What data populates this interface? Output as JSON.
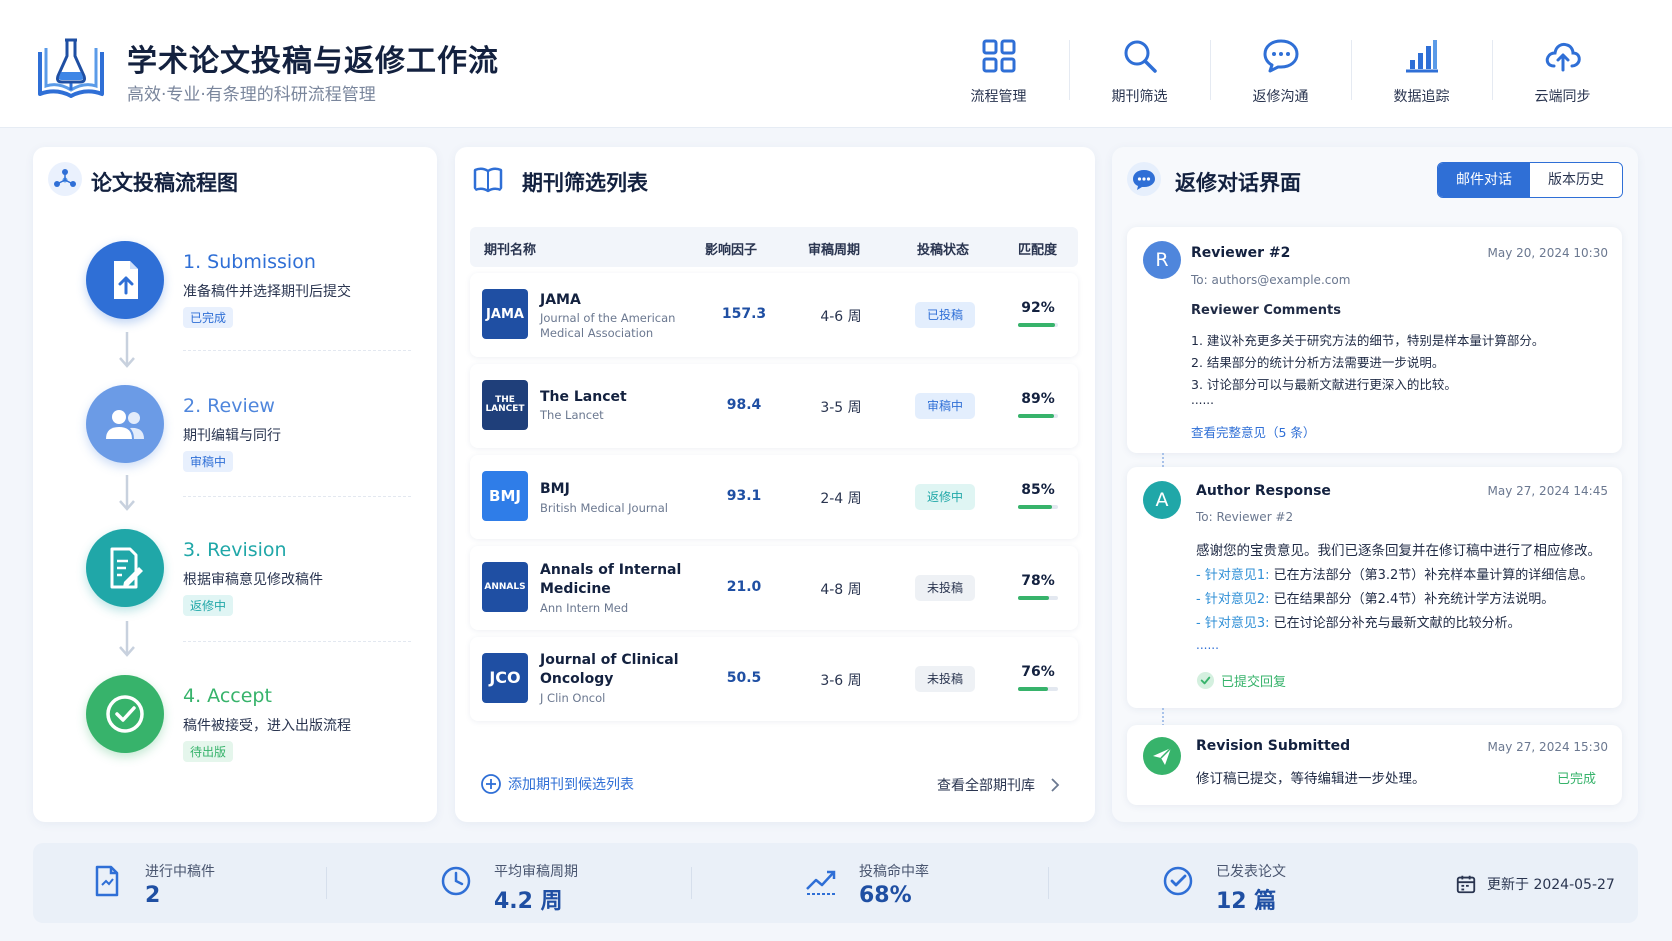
{
  "header": {
    "title": "学术论文投稿与返修工作流",
    "subtitle": "高效·专业·有条理的科研流程管理",
    "nav": [
      {
        "label": "流程管理",
        "icon": "grid-icon"
      },
      {
        "label": "期刊筛选",
        "icon": "search-icon"
      },
      {
        "label": "返修沟通",
        "icon": "chat-icon"
      },
      {
        "label": "数据追踪",
        "icon": "bar-chart-icon"
      },
      {
        "label": "云端同步",
        "icon": "cloud-upload-icon"
      }
    ]
  },
  "flow": {
    "title": "论文投稿流程图",
    "steps": [
      {
        "name": "1. Submission",
        "desc": "准备稿件并选择期刊后提交",
        "badge": "已完成",
        "color": "#2f6fd6",
        "icon": "upload-file-icon"
      },
      {
        "name": "2. Review",
        "desc": "期刊编辑与同行",
        "badge": "审稿中",
        "color": "#5b8fe0",
        "icon": "users-icon"
      },
      {
        "name": "3. Revision",
        "desc": "根据审稿意见修改稿件",
        "badge": "返修中",
        "color": "#20a7a8",
        "icon": "edit-document-icon"
      },
      {
        "name": "4. Accept",
        "desc": "稿件被接受，进入出版流程",
        "badge": "待出版",
        "color": "#37b36b",
        "icon": "check-circle-icon"
      }
    ]
  },
  "journals": {
    "title": "期刊筛选列表",
    "headers": [
      "期刊名称",
      "影响因子",
      "审稿周期",
      "投稿状态",
      "匹配度"
    ],
    "rows": [
      {
        "logo": "JAMA",
        "name": "JAMA",
        "sub": "Journal of the American Medical Association",
        "if": "157.3",
        "cycle": "4-6 周",
        "status": "已投稿",
        "status_kind": "blue",
        "match": "92%",
        "match_value": 0.92
      },
      {
        "logo": "THE LANCET",
        "name": "The Lancet",
        "sub": "The Lancet",
        "if": "98.4",
        "cycle": "3-5 周",
        "status": "审稿中",
        "status_kind": "blue",
        "match": "89%",
        "match_value": 0.89
      },
      {
        "logo": "BMJ",
        "name": "BMJ",
        "sub": "British Medical Journal",
        "if": "93.1",
        "cycle": "2-4 周",
        "status": "返修中",
        "status_kind": "teal",
        "match": "85%",
        "match_value": 0.85
      },
      {
        "logo": "ANNALS",
        "name": "Annals of Internal Medicine",
        "sub": "Ann Intern Med",
        "if": "21.0",
        "cycle": "4-8 周",
        "status": "未投稿",
        "status_kind": "gray",
        "match": "78%",
        "match_value": 0.78
      },
      {
        "logo": "JCO",
        "name": "Journal of Clinical Oncology",
        "sub": "J Clin Oncol",
        "if": "50.5",
        "cycle": "3-6 周",
        "status": "未投稿",
        "status_kind": "gray",
        "match": "76%",
        "match_value": 0.76
      }
    ],
    "add_link": "添加期刊到候选列表",
    "view_all": "查看全部期刊库"
  },
  "revision": {
    "title": "返修对话界面",
    "tabs": [
      "邮件对话",
      "版本历史"
    ],
    "messages": [
      {
        "avatar": "R",
        "from": "Reviewer #2",
        "date": "May 20, 2024  10:30",
        "to": "To: authors@example.com",
        "heading": "Reviewer Comments",
        "lines": [
          "1. 建议补充更多关于研究方法的细节，特别是样本量计算部分。",
          "2. 结果部分的统计分析方法需要进一步说明。",
          "3. 讨论部分可以与最新文献进行更深入的比较。",
          "......"
        ],
        "link": "查看完整意见（5 条）"
      },
      {
        "avatar": "A",
        "from": "Author Response",
        "date": "May 27, 2024  14:45",
        "to": "To: Reviewer #2",
        "intro": "感谢您的宝贵意见。我们已逐条回复并在修订稿中进行了相应修改。",
        "points": [
          {
            "tag": "- 针对意见1:",
            "text": "已在方法部分（第3.2节）补充样本量计算的详细信息。"
          },
          {
            "tag": "- 针对意见2:",
            "text": "已在结果部分（第2.4节）补充统计学方法说明。"
          },
          {
            "tag": "- 针对意见3:",
            "text": "已在讨论部分补充与最新文献的比较分析。"
          }
        ],
        "ellipsis": "......",
        "status": "已提交回复"
      },
      {
        "from": "Revision Submitted",
        "date": "May 27, 2024  15:30",
        "text": "修订稿已提交，等待编辑进一步处理。",
        "status": "已完成"
      }
    ]
  },
  "stats": [
    {
      "label": "进行中稿件",
      "value": "2",
      "icon": "document-icon"
    },
    {
      "label": "平均审稿周期",
      "value": "4.2 周",
      "icon": "clock-icon"
    },
    {
      "label": "投稿命中率",
      "value": "68%",
      "icon": "trend-icon"
    },
    {
      "label": "已发表论文",
      "value": "12 篇",
      "icon": "badge-check-icon"
    }
  ],
  "updated": "更新于 2024-05-27",
  "colors": {
    "primary": "#2f6fd6",
    "teal": "#20a7a8",
    "green": "#37b36b",
    "navy": "#1f4fa3"
  }
}
